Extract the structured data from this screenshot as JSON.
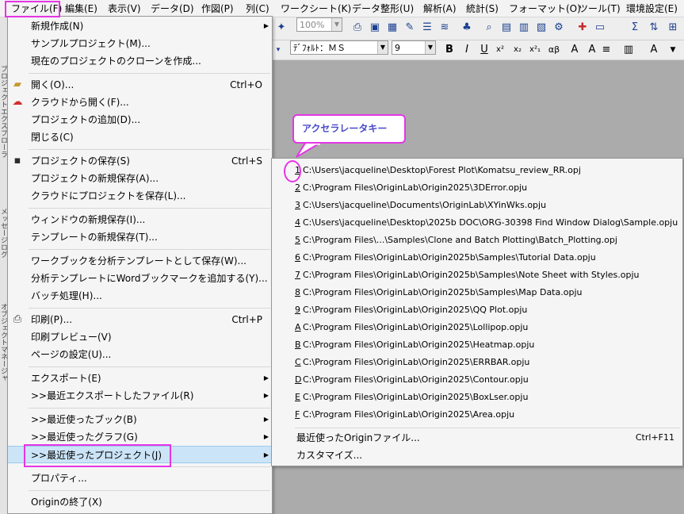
{
  "menubar": {
    "items": [
      {
        "label": "ファイル(F)"
      },
      {
        "label": "編集(E)"
      },
      {
        "label": "表示(V)"
      },
      {
        "label": "データ(D)"
      },
      {
        "label": "作図(P)"
      },
      {
        "label": "列(C)"
      },
      {
        "label": "ワークシート(K)"
      },
      {
        "label": "データ整形(U)"
      },
      {
        "label": "解析(A)"
      },
      {
        "label": "統計(S)"
      },
      {
        "label": "フォーマット(O)"
      },
      {
        "label": "ツール(T)"
      },
      {
        "label": "環境設定(E)"
      }
    ]
  },
  "toolbar": {
    "zoom_value": "100%",
    "font_name": "ﾃﾞﾌｫﾙﾄ：ＭＳ",
    "font_size": "9",
    "bold": "B",
    "italic": "I",
    "underline": "U",
    "superscript": "x²",
    "subscript": "x₂",
    "supsub": "x²₁",
    "greek": "αβ"
  },
  "left_panel": {
    "labels": [
      "プロジェクトエクスプローラ",
      "メッセージログ",
      "オブジェクトマネージャ"
    ]
  },
  "file_menu": {
    "items": [
      {
        "label": "新規作成(N)",
        "shortcut": "",
        "submenu": true
      },
      {
        "label": "サンプルプロジェクト(M)...",
        "shortcut": ""
      },
      {
        "label": "現在のプロジェクトのクローンを作成...",
        "shortcut": ""
      },
      {
        "label": "開く(O)...",
        "shortcut": "Ctrl+O",
        "icon": "open-folder-icon"
      },
      {
        "label": "クラウドから開く(F)...",
        "shortcut": "",
        "icon": "cloud-download-icon"
      },
      {
        "label": "プロジェクトの追加(D)...",
        "shortcut": ""
      },
      {
        "label": "閉じる(C)",
        "shortcut": ""
      },
      {
        "label": "プロジェクトの保存(S)",
        "shortcut": "Ctrl+S",
        "icon": "save-disk-icon"
      },
      {
        "label": "プロジェクトの新規保存(A)...",
        "shortcut": ""
      },
      {
        "label": "クラウドにプロジェクトを保存(L)...",
        "shortcut": ""
      },
      {
        "label": "ウィンドウの新規保存(I)...",
        "shortcut": ""
      },
      {
        "label": "テンプレートの新規保存(T)...",
        "shortcut": ""
      },
      {
        "label": "ワークブックを分析テンプレートとして保存(W)...",
        "shortcut": ""
      },
      {
        "label": "分析テンプレートにWordブックマークを追加する(Y)...",
        "shortcut": ""
      },
      {
        "label": "バッチ処理(H)...",
        "shortcut": ""
      },
      {
        "label": "印刷(P)...",
        "shortcut": "Ctrl+P",
        "icon": "printer-icon"
      },
      {
        "label": "印刷プレビュー(V)",
        "shortcut": ""
      },
      {
        "label": "ページの設定(U)...",
        "shortcut": ""
      },
      {
        "label": "エクスポート(E)",
        "shortcut": "",
        "submenu": true
      },
      {
        "label": ">>最近エクスポートしたファイル(R)",
        "shortcut": "",
        "submenu": true
      },
      {
        "label": ">>最近使ったブック(B)",
        "shortcut": "",
        "submenu": true
      },
      {
        "label": ">>最近使ったグラフ(G)",
        "shortcut": "",
        "submenu": true
      },
      {
        "label": ">>最近使ったプロジェクト(J)",
        "shortcut": "",
        "submenu": true,
        "selected": true
      },
      {
        "label": "プロパティ...",
        "shortcut": ""
      },
      {
        "label": "Originの終了(X)",
        "shortcut": ""
      }
    ]
  },
  "recent_projects": {
    "items": [
      {
        "key": "1",
        "path": "C:\\Users\\jacqueline\\Desktop\\Forest Plot\\Komatsu_review_RR.opj"
      },
      {
        "key": "2",
        "path": "C:\\Program Files\\OriginLab\\Origin2025\\3DError.opju"
      },
      {
        "key": "3",
        "path": "C:\\Users\\jacqueline\\Documents\\OriginLab\\XYinWks.opju"
      },
      {
        "key": "4",
        "path": "C:\\Users\\jacqueline\\Desktop\\2025b DOC\\ORG-30398 Find Window Dialog\\Sample.opju"
      },
      {
        "key": "5",
        "path": "C:\\Program Files\\...\\Samples\\Clone and Batch Plotting\\Batch_Plotting.opj"
      },
      {
        "key": "6",
        "path": "C:\\Program Files\\OriginLab\\Origin2025b\\Samples\\Tutorial Data.opju"
      },
      {
        "key": "7",
        "path": "C:\\Program Files\\OriginLab\\Origin2025b\\Samples\\Note Sheet with Styles.opju"
      },
      {
        "key": "8",
        "path": "C:\\Program Files\\OriginLab\\Origin2025b\\Samples\\Map Data.opju"
      },
      {
        "key": "9",
        "path": "C:\\Program Files\\OriginLab\\Origin2025\\QQ Plot.opju"
      },
      {
        "key": "A",
        "path": "C:\\Program Files\\OriginLab\\Origin2025\\Lollipop.opju"
      },
      {
        "key": "B",
        "path": "C:\\Program Files\\OriginLab\\Origin2025\\Heatmap.opju"
      },
      {
        "key": "C",
        "path": "C:\\Program Files\\OriginLab\\Origin2025\\ERRBAR.opju"
      },
      {
        "key": "D",
        "path": "C:\\Program Files\\OriginLab\\Origin2025\\Contour.opju"
      },
      {
        "key": "E",
        "path": "C:\\Program Files\\OriginLab\\Origin2025\\BoxLser.opju"
      },
      {
        "key": "F",
        "path": "C:\\Program Files\\OriginLab\\Origin2025\\Area.opju"
      }
    ],
    "more_label": "最近使ったOriginファイル...",
    "more_shortcut": "Ctrl+F11",
    "customize_label": "カスタマイズ..."
  },
  "annotation": {
    "callout_text": "アクセラレータキー",
    "highlight_color": "#e535e5"
  }
}
